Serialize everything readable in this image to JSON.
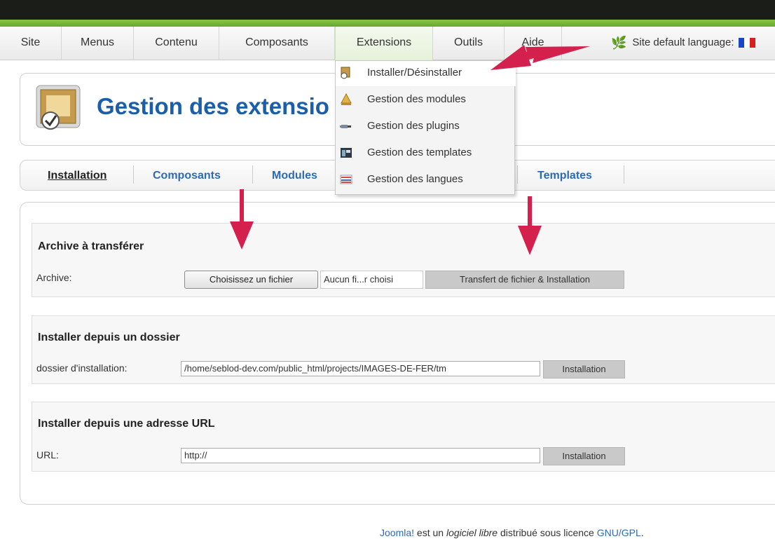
{
  "menubar": {
    "items": [
      "Site",
      "Menus",
      "Contenu",
      "Composants",
      "Extensions",
      "Outils",
      "Aide"
    ],
    "active": "Extensions",
    "language_label": "Site default language:"
  },
  "dropdown": {
    "items": [
      {
        "label": "Installer/Désinstaller",
        "icon": "install-icon"
      },
      {
        "label": "Gestion des modules",
        "icon": "modules-icon"
      },
      {
        "label": "Gestion des plugins",
        "icon": "plugins-icon"
      },
      {
        "label": "Gestion des templates",
        "icon": "templates-icon"
      },
      {
        "label": "Gestion des langues",
        "icon": "languages-icon"
      }
    ]
  },
  "header": {
    "title": "Gestion des extensio",
    "icon": "extension-manager-icon"
  },
  "subtabs": {
    "items": [
      "Installation",
      "Composants",
      "Modules",
      "Templates"
    ],
    "current": "Installation"
  },
  "upload": {
    "heading": "Archive à transférer",
    "label": "Archive:",
    "choose_button": "Choisissez un fichier",
    "no_file_text": "Aucun fi...r choisi",
    "submit_button": "Transfert de fichier & Installation"
  },
  "folder": {
    "heading": "Installer depuis un dossier",
    "label": "dossier d'installation:",
    "value": "/home/seblod-dev.com/public_html/projects/IMAGES-DE-FER/tm",
    "submit_button": "Installation"
  },
  "url": {
    "heading": "Installer depuis une adresse URL",
    "label": "URL:",
    "value": "http://",
    "submit_button": "Installation"
  },
  "footer": {
    "joomla": "Joomla!",
    "part1": " est un ",
    "italic": "logiciel libre",
    "part2": " distribué sous licence ",
    "license": "GNU/GPL",
    "end": "."
  },
  "colors": {
    "accent_green": "#6aa52c",
    "title_blue": "#1a5fa8",
    "arrow_red": "#d4204c"
  }
}
